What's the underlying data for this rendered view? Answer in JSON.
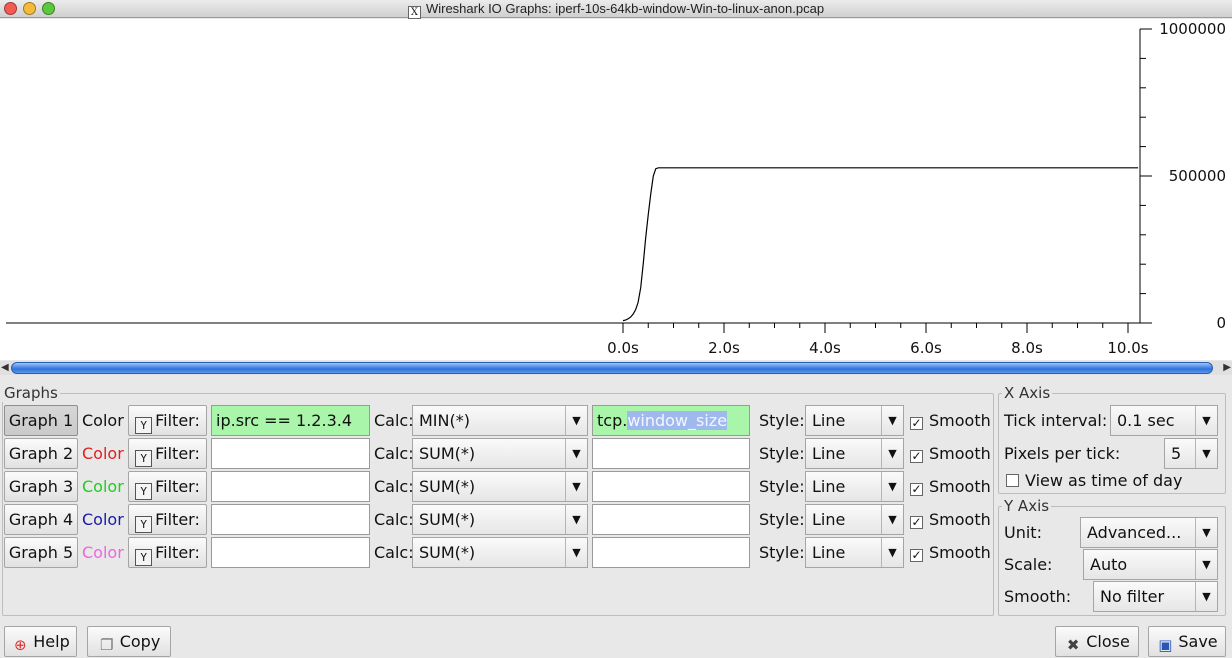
{
  "window": {
    "title": "Wireshark IO Graphs: iperf-10s-64kb-window-Win-to-linux-anon.pcap"
  },
  "chart_data": {
    "type": "line",
    "x": [
      0.0,
      0.05,
      0.1,
      0.15,
      0.2,
      0.25,
      0.3,
      0.35,
      0.4,
      0.45,
      0.5,
      0.55,
      0.6,
      0.65,
      0.7,
      0.75,
      0.8,
      0.85,
      0.9,
      0.95,
      1.0,
      2.0,
      3.0,
      4.0,
      5.0,
      6.0,
      7.0,
      8.0,
      9.0,
      10.0,
      10.2
    ],
    "y": [
      8000,
      10000,
      14000,
      20000,
      30000,
      45000,
      70000,
      120000,
      200000,
      290000,
      370000,
      440000,
      500000,
      525000,
      528000,
      528000,
      528000,
      528000,
      528000,
      528000,
      528000,
      528000,
      528000,
      528000,
      528000,
      528000,
      528000,
      528000,
      528000,
      528000,
      528000
    ],
    "x_ticks": [
      "0.0s",
      "2.0s",
      "4.0s",
      "6.0s",
      "8.0s",
      "10.0s"
    ],
    "y_ticks": [
      "1000000",
      "500000",
      "0"
    ],
    "xlim": [
      0,
      10.2
    ],
    "ylim": [
      0,
      1000000
    ],
    "line_color": "#000000"
  },
  "graphs_group": {
    "title": "Graphs"
  },
  "graphs": [
    {
      "button": "Graph 1",
      "color_label": "Color",
      "color": "#111111",
      "filter_btn": "Filter:",
      "filter_value": "ip.src == 1.2.3.4",
      "calc_label": "Calc:",
      "calc": "MIN(*)",
      "calc_field_pre": "tcp.",
      "calc_field_sel": "window_size",
      "style_label": "Style:",
      "style": "Line",
      "smooth": "Smooth"
    },
    {
      "button": "Graph 2",
      "color_label": "Color",
      "color": "#e02020",
      "filter_btn": "Filter:",
      "filter_value": "",
      "calc_label": "Calc:",
      "calc": "SUM(*)",
      "calc_field_pre": "",
      "calc_field_sel": "",
      "style_label": "Style:",
      "style": "Line",
      "smooth": "Smooth"
    },
    {
      "button": "Graph 3",
      "color_label": "Color",
      "color": "#22cc22",
      "filter_btn": "Filter:",
      "filter_value": "",
      "calc_label": "Calc:",
      "calc": "SUM(*)",
      "calc_field_pre": "",
      "calc_field_sel": "",
      "style_label": "Style:",
      "style": "Line",
      "smooth": "Smooth"
    },
    {
      "button": "Graph 4",
      "color_label": "Color",
      "color": "#1a1aaa",
      "filter_btn": "Filter:",
      "filter_value": "",
      "calc_label": "Calc:",
      "calc": "SUM(*)",
      "calc_field_pre": "",
      "calc_field_sel": "",
      "style_label": "Style:",
      "style": "Line",
      "smooth": "Smooth"
    },
    {
      "button": "Graph 5",
      "color_label": "Color",
      "color": "#ee66dd",
      "filter_btn": "Filter:",
      "filter_value": "",
      "calc_label": "Calc:",
      "calc": "SUM(*)",
      "calc_field_pre": "",
      "calc_field_sel": "",
      "style_label": "Style:",
      "style": "Line",
      "smooth": "Smooth"
    }
  ],
  "x_axis": {
    "title": "X Axis",
    "tick_interval_label": "Tick interval:",
    "tick_interval": "0.1 sec",
    "pixels_per_tick_label": "Pixels per tick:",
    "pixels_per_tick": "5",
    "time_of_day_label": "View as time of day"
  },
  "y_axis": {
    "title": "Y Axis",
    "unit_label": "Unit:",
    "unit": "Advanced...",
    "scale_label": "Scale:",
    "scale": "Auto",
    "smooth_label": "Smooth:",
    "smooth": "No filter"
  },
  "footer": {
    "help": "Help",
    "copy": "Copy",
    "close": "Close",
    "save": "Save"
  }
}
